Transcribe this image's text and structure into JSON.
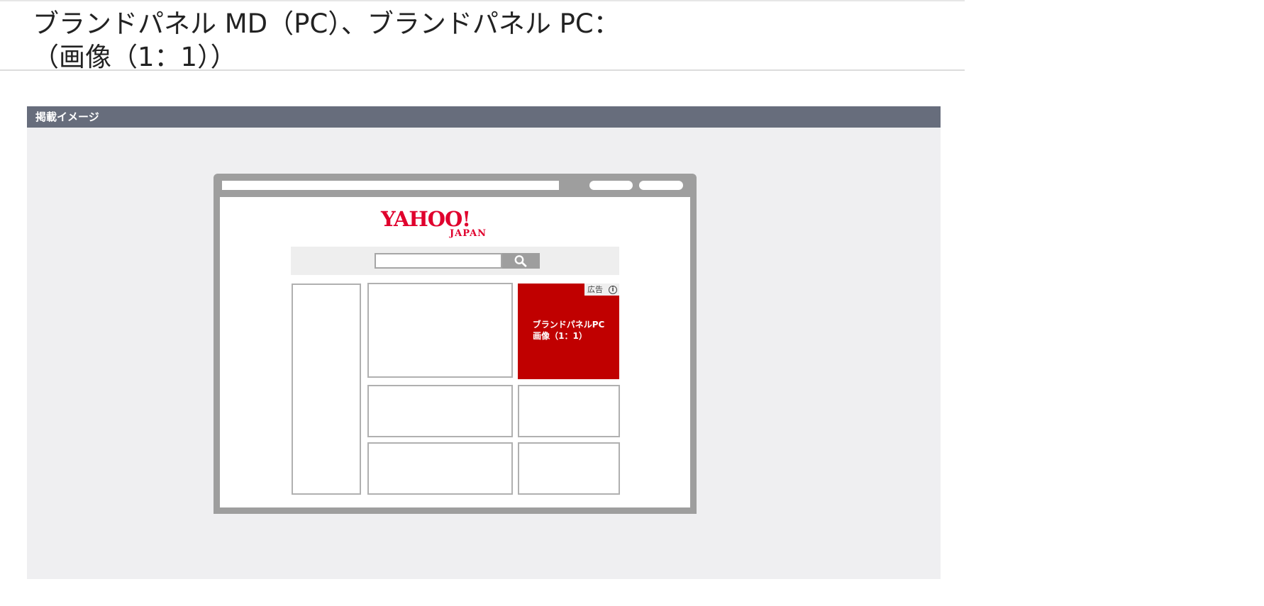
{
  "page": {
    "title_line1": "ブランドパネル MD（PC）、ブランドパネル PC：",
    "title_line2": "（画像（1：1））"
  },
  "panel": {
    "title": "掲載イメージ"
  },
  "mockup": {
    "logo_main": "YAHOO!",
    "logo_sub": "JAPAN",
    "search_icon": "search-icon",
    "ad_badge": "広告",
    "ad_info_icon": "info-icon",
    "ad_line1": "ブランドパネルPC",
    "ad_line2": "画像（1：1）"
  },
  "colors": {
    "panel_header": "#676d7c",
    "panel_background": "#efeff1",
    "browser_frame": "#9e9e9e",
    "ad_red": "#c00000",
    "logo_red": "#e0002d"
  }
}
